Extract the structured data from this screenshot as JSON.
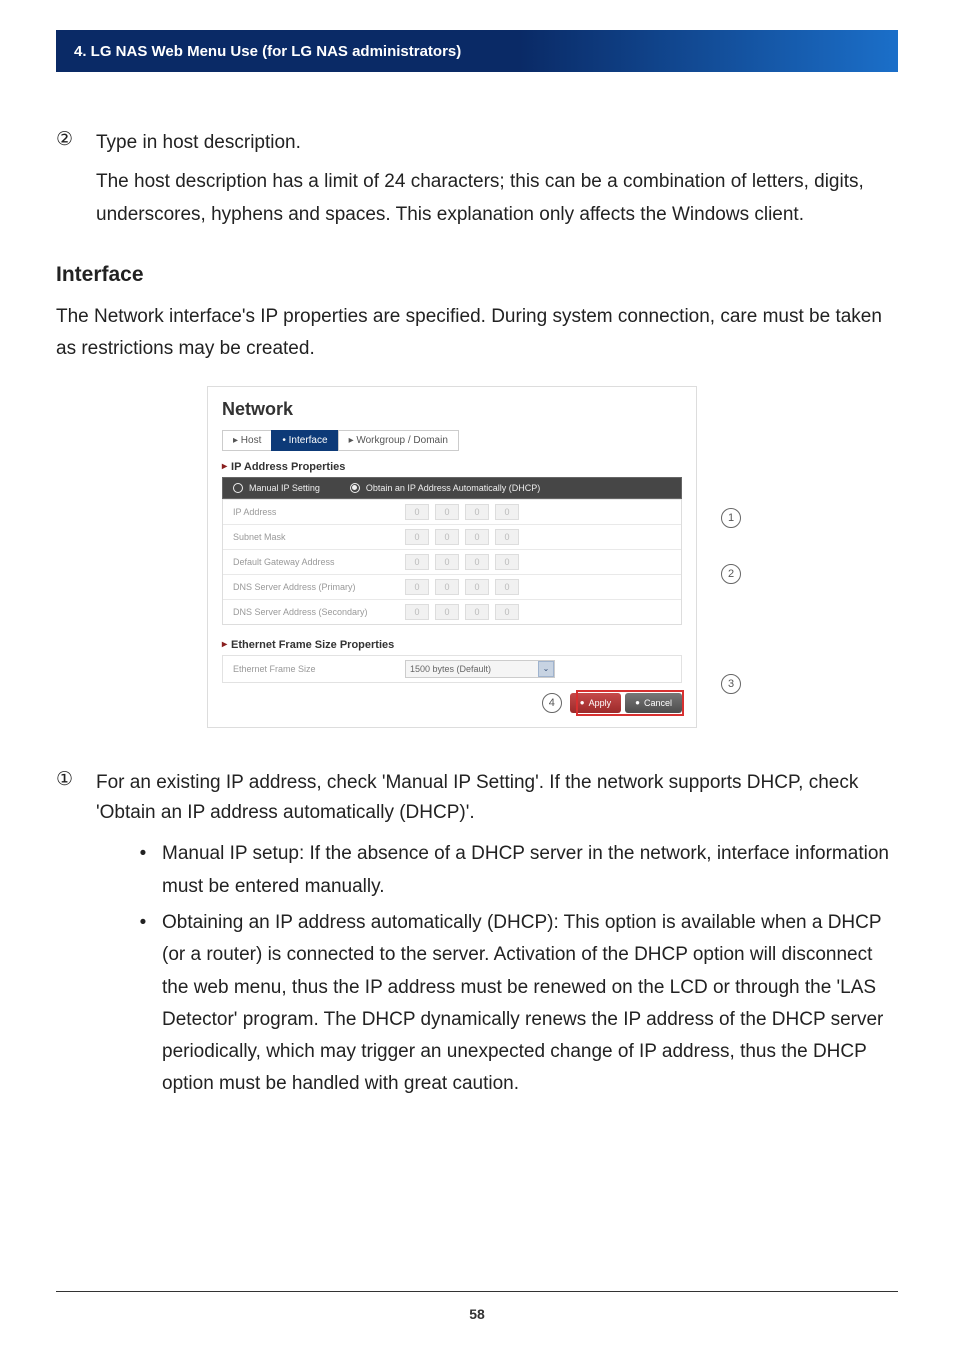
{
  "header": "4. LG NAS Web Menu Use (for LG NAS administrators)",
  "step2": {
    "num": "②",
    "title": "Type in host description.",
    "desc": "The host description has a limit of 24 characters; this can be a combination of letters, digits, underscores, hyphens and spaces. This explanation only affects the Windows client."
  },
  "interface": {
    "heading": "Interface",
    "intro": "The Network interface's IP properties are specified. During system connection, care must be taken as restrictions may be created."
  },
  "shot": {
    "title": "Network",
    "tabs": {
      "host": "▸ Host",
      "interface": "• Interface",
      "workgroup": "▸ Workgroup / Domain"
    },
    "ip_section_label": "IP Address Properties",
    "radio_manual": "Manual IP Setting",
    "radio_dhcp": "Obtain an IP Address Automatically (DHCP)",
    "rows": [
      {
        "label": "IP Address",
        "o": [
          "0",
          "0",
          "0",
          "0"
        ]
      },
      {
        "label": "Subnet Mask",
        "o": [
          "0",
          "0",
          "0",
          "0"
        ]
      },
      {
        "label": "Default Gateway Address",
        "o": [
          "0",
          "0",
          "0",
          "0"
        ]
      },
      {
        "label": "DNS Server Address (Primary)",
        "o": [
          "0",
          "0",
          "0",
          "0"
        ]
      },
      {
        "label": "DNS Server Address (Secondary)",
        "o": [
          "0",
          "0",
          "0",
          "0"
        ]
      }
    ],
    "eth_section_label": "Ethernet Frame Size Properties",
    "eth_row_label": "Ethernet Frame Size",
    "eth_value": "1500 bytes (Default)",
    "apply_label": "Apply",
    "cancel_label": "Cancel"
  },
  "callouts": {
    "c1": "1",
    "c2": "2",
    "c3": "3",
    "c4": "4"
  },
  "step1": {
    "num": "①",
    "text": "For an existing IP address, check 'Manual IP Setting'. If the network supports DHCP, check 'Obtain an IP address automatically (DHCP)'.",
    "bullets": [
      "Manual IP setup: If the absence of a DHCP server in the network, interface information must be entered manually.",
      "Obtaining an IP address automatically (DHCP): This option is available when a DHCP (or a router) is connected to the server. Activation of the DHCP option will disconnect the web menu, thus the IP address must be renewed on the LCD or through the 'LAS Detector' program. The DHCP dynamically renews the IP address of the DHCP server periodically, which may trigger an unexpected change of IP address, thus the DHCP option must be handled with great caution."
    ]
  },
  "page_number": "58"
}
